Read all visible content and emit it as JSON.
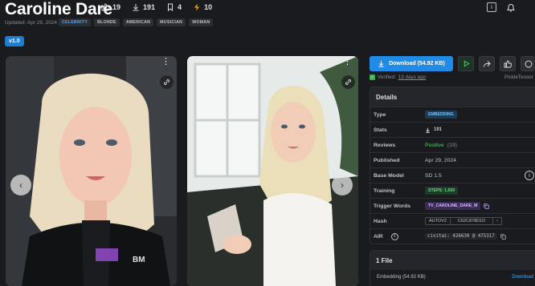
{
  "model": {
    "title": "Caroline Dare",
    "stats": {
      "likes": "19",
      "downloads": "191",
      "bookmarks": "4",
      "buzz": "10"
    },
    "updated": "Updated: Apr 29, 2024",
    "tags": [
      "CELEBRITY",
      "BLONDE",
      "AMERICAN",
      "MUSICIAN",
      "WOMAN"
    ],
    "version": "v1.0"
  },
  "actions": {
    "download_label": "Download (54.92 KB)",
    "verified_prefix": "Verified:",
    "verified_when": "13 days ago",
    "author": "PickleTensor"
  },
  "details": {
    "heading": "Details",
    "rows": [
      {
        "label": "Type",
        "value": "EMBEDDING"
      },
      {
        "label": "Stats",
        "value": "191"
      },
      {
        "label": "Reviews",
        "value": "Positive",
        "count": "(19)"
      },
      {
        "label": "Published",
        "value": "Apr 29, 2024"
      },
      {
        "label": "Base Model",
        "value": "SD 1.5"
      },
      {
        "label": "Training",
        "value": "STEPS: 1,650"
      },
      {
        "label": "Trigger Words",
        "value": "TV_CAROLINE_DARE_M"
      },
      {
        "label": "Hash",
        "algo": "AUTOV2",
        "value": "C62C878D1D"
      },
      {
        "label": "AIR",
        "value": "civitai: 426630 @ 475317"
      }
    ]
  },
  "files": {
    "heading": "1 File",
    "file_name": "Embedding (54.92 KB)",
    "download": "Download"
  },
  "colors": {
    "accent": "#228be6",
    "positive": "#51cf66",
    "background": "#1a1b1e"
  }
}
